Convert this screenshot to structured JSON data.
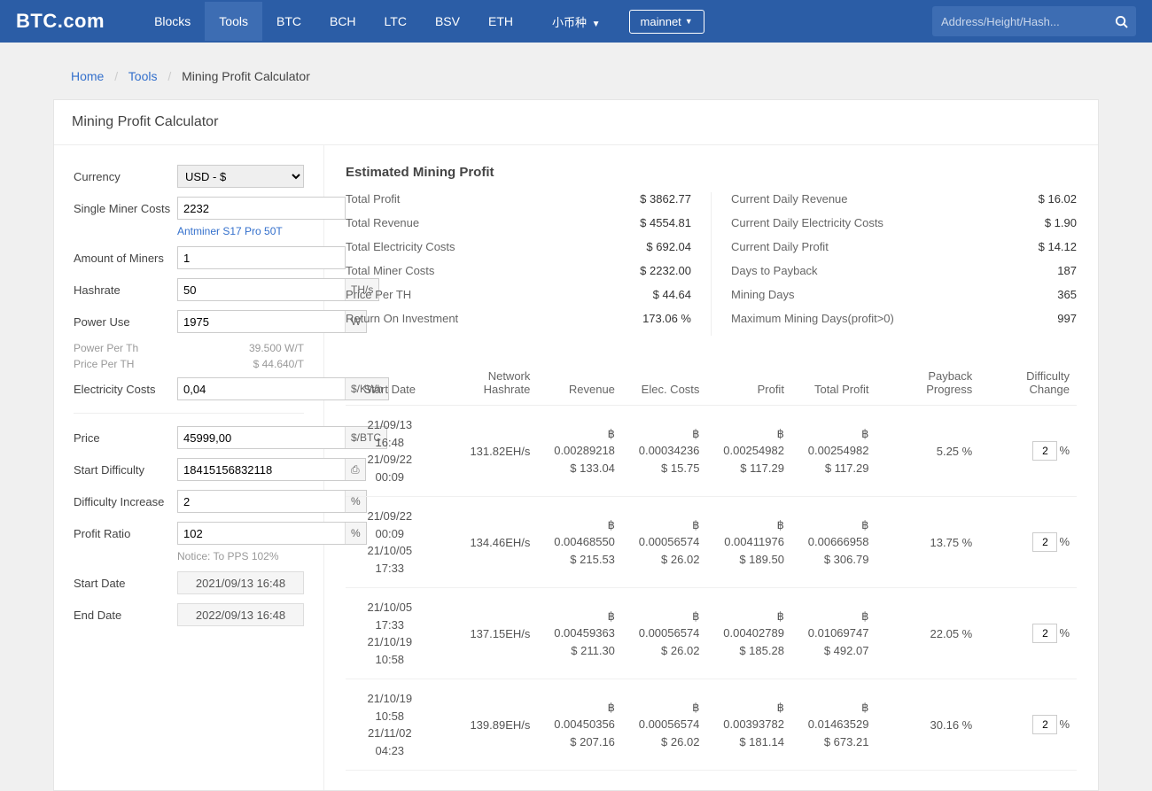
{
  "nav": {
    "logo": "BTC.com",
    "items": [
      "Blocks",
      "Tools",
      "BTC",
      "BCH",
      "LTC",
      "BSV",
      "ETH"
    ],
    "active": 1,
    "dropdown": "小币种",
    "network": "mainnet",
    "searchPlaceholder": "Address/Height/Hash..."
  },
  "breadcrumb": {
    "home": "Home",
    "tools": "Tools",
    "current": "Mining Profit Calculator"
  },
  "pageTitle": "Mining Profit Calculator",
  "form": {
    "currencyLabel": "Currency",
    "currencyValue": "USD - $",
    "singleMinerLabel": "Single Miner Costs",
    "singleMinerValue": "2232",
    "minerLink": "Antminer S17 Pro 50T",
    "amountLabel": "Amount of Miners",
    "amountValue": "1",
    "hashrateLabel": "Hashrate",
    "hashrateValue": "50",
    "hashrateUnit": "TH/s",
    "powerUseLabel": "Power Use",
    "powerUseValue": "1975",
    "powerUseUnit": "W",
    "powerPerThLabel": "Power Per Th",
    "powerPerThValue": "39.500 W/T",
    "pricePerThLabel": "Price Per TH",
    "pricePerThValue": "$ 44.640/T",
    "elecLabel": "Electricity Costs",
    "elecValue": "0,04",
    "elecUnit": "$/KWh",
    "priceLabel": "Price",
    "priceValue": "45999,00",
    "priceUnit": "$/BTC",
    "startDiffLabel": "Start Difficulty",
    "startDiffValue": "18415156832118",
    "startDiffUnit": "⎙",
    "diffIncLabel": "Difficulty Increase",
    "diffIncValue": "2",
    "diffIncUnit": "%",
    "profitRatioLabel": "Profit Ratio",
    "profitRatioValue": "102",
    "profitRatioUnit": "%",
    "notice": "Notice: To PPS 102%",
    "startDateLabel": "Start Date",
    "startDateValue": "2021/09/13 16:48",
    "endDateLabel": "End Date",
    "endDateValue": "2022/09/13 16:48"
  },
  "summaryTitle": "Estimated Mining Profit",
  "summaryLeft": [
    {
      "label": "Total Profit",
      "value": "$ 3862.77"
    },
    {
      "label": "Total Revenue",
      "value": "$ 4554.81"
    },
    {
      "label": "Total Electricity Costs",
      "value": "$ 692.04"
    },
    {
      "label": "Total Miner Costs",
      "value": "$ 2232.00"
    },
    {
      "label": "Price Per TH",
      "value": "$ 44.64"
    },
    {
      "label": "Return On Investment",
      "value": "173.06 %"
    }
  ],
  "summaryRight": [
    {
      "label": "Current Daily Revenue",
      "value": "$ 16.02"
    },
    {
      "label": "Current Daily Electricity Costs",
      "value": "$ 1.90"
    },
    {
      "label": "Current Daily Profit",
      "value": "$ 14.12"
    },
    {
      "label": "Days to Payback",
      "value": "187"
    },
    {
      "label": "Mining Days",
      "value": "365"
    },
    {
      "label": "Maximum Mining Days(profit>0)",
      "value": "997"
    }
  ],
  "tableHeaders": {
    "startDate": "Start Date",
    "networkHashrate": "Network Hashrate",
    "revenue": "Revenue",
    "elecCosts": "Elec. Costs",
    "profit": "Profit",
    "totalProfit": "Total Profit",
    "payback": "Payback Progress",
    "diffChange": "Difficulty Change"
  },
  "tableRows": [
    {
      "d1": "21/09/13 16:48",
      "d2": "21/09/22 00:09",
      "nh": "131.82EH/s",
      "rev1": "฿ 0.00289218",
      "rev2": "$ 133.04",
      "ec1": "฿ 0.00034236",
      "ec2": "$ 15.75",
      "pr1": "฿ 0.00254982",
      "pr2": "$ 117.29",
      "tp1": "฿ 0.00254982",
      "tp2": "$ 117.29",
      "pb": "5.25 %",
      "dc": "2"
    },
    {
      "d1": "21/09/22 00:09",
      "d2": "21/10/05 17:33",
      "nh": "134.46EH/s",
      "rev1": "฿ 0.00468550",
      "rev2": "$ 215.53",
      "ec1": "฿ 0.00056574",
      "ec2": "$ 26.02",
      "pr1": "฿ 0.00411976",
      "pr2": "$ 189.50",
      "tp1": "฿ 0.00666958",
      "tp2": "$ 306.79",
      "pb": "13.75 %",
      "dc": "2"
    },
    {
      "d1": "21/10/05 17:33",
      "d2": "21/10/19 10:58",
      "nh": "137.15EH/s",
      "rev1": "฿ 0.00459363",
      "rev2": "$ 211.30",
      "ec1": "฿ 0.00056574",
      "ec2": "$ 26.02",
      "pr1": "฿ 0.00402789",
      "pr2": "$ 185.28",
      "tp1": "฿ 0.01069747",
      "tp2": "$ 492.07",
      "pb": "22.05 %",
      "dc": "2"
    },
    {
      "d1": "21/10/19 10:58",
      "d2": "21/11/02 04:23",
      "nh": "139.89EH/s",
      "rev1": "฿ 0.00450356",
      "rev2": "$ 207.16",
      "ec1": "฿ 0.00056574",
      "ec2": "$ 26.02",
      "pr1": "฿ 0.00393782",
      "pr2": "$ 181.14",
      "tp1": "฿ 0.01463529",
      "tp2": "$ 673.21",
      "pb": "30.16 %",
      "dc": "2"
    }
  ]
}
